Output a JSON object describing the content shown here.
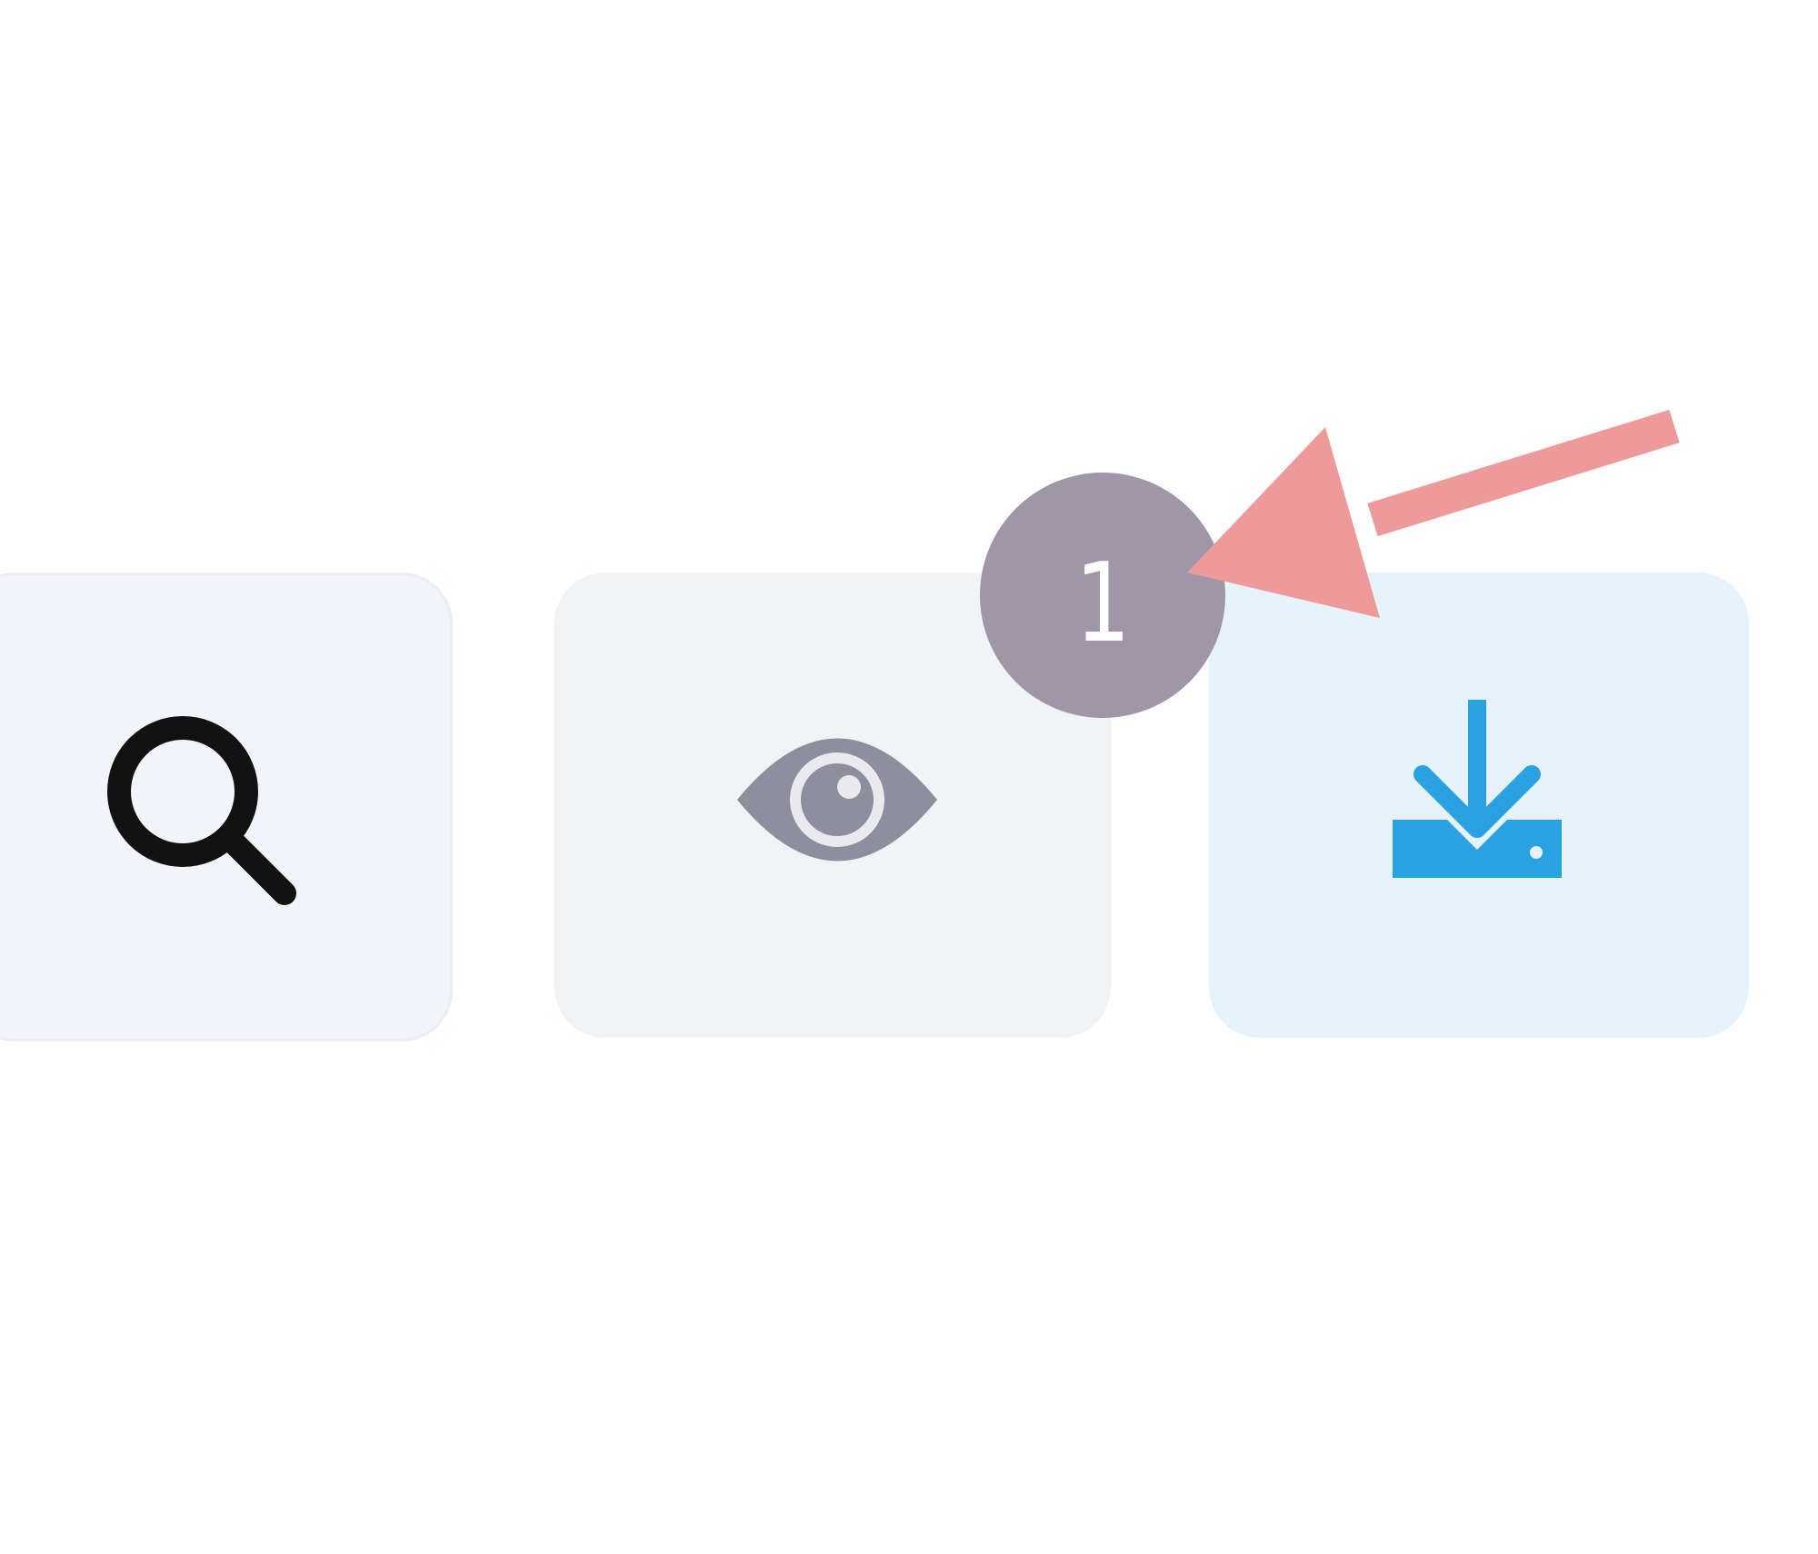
{
  "toolbar": {
    "buttons": [
      {
        "name": "search",
        "icon": "search-icon",
        "icon_color": "#111111"
      },
      {
        "name": "preview",
        "icon": "eye-icon",
        "icon_color": "#8d8f9e"
      },
      {
        "name": "download",
        "icon": "download-icon",
        "icon_color": "#2aa2e2"
      }
    ]
  },
  "annotation": {
    "step_number": "1",
    "badge_color": "#9f97a7",
    "arrow_color": "#ef9a9a",
    "target": "download"
  }
}
